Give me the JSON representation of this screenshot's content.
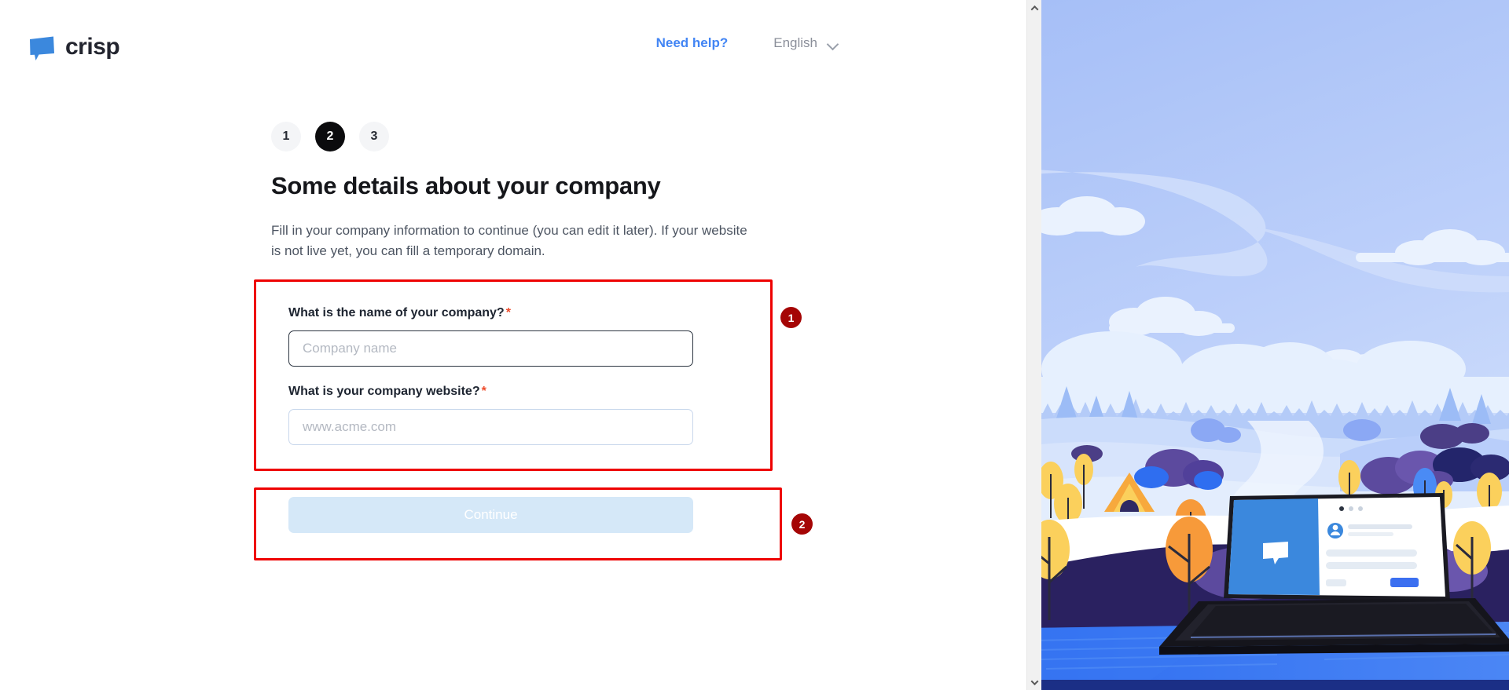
{
  "brand": {
    "logo_text": "crisp",
    "logo_icon": "speech-bubble-icon",
    "logo_color": "#3b88dd"
  },
  "header": {
    "need_help_label": "Need help?",
    "language_label": "English",
    "language_chevron_icon": "chevron-down-icon"
  },
  "onboarding": {
    "steps": [
      {
        "label": "1",
        "active": false
      },
      {
        "label": "2",
        "active": true
      },
      {
        "label": "3",
        "active": false
      }
    ],
    "title": "Some details about your company",
    "description": "Fill in your company information to continue (you can edit it later). If your website is not live yet, you can fill a temporary domain."
  },
  "form": {
    "fields": [
      {
        "label": "What is the name of your company?",
        "required_marker": "*",
        "placeholder": "Company name",
        "value": "",
        "focused": true
      },
      {
        "label": "What is your company website?",
        "required_marker": "*",
        "placeholder": "www.acme.com",
        "value": "",
        "focused": false
      }
    ],
    "submit_label": "Continue",
    "submit_disabled": true
  },
  "annotations": [
    {
      "badge": "1",
      "target": "company-fields-group"
    },
    {
      "badge": "2",
      "target": "continue-button"
    }
  ],
  "scrollbar": {
    "up_arrow_icon": "chevron-up-icon",
    "down_arrow_icon": "chevron-down-icon"
  },
  "illustration": {
    "name": "winter-landscape-with-laptop-illustration",
    "colors": {
      "sky_top": "#a9c1f6",
      "sky_bottom": "#cfe0fb",
      "snow": "#ffffff",
      "night_ground": "#2a2160",
      "desk_blue": "#2f6ef0",
      "tree_orange": "#f79a3a",
      "tree_yellow": "#f9cf52",
      "bush_purple": "#5c4a9e",
      "accent_blue": "#3b88dd"
    }
  },
  "colors": {
    "accent": "#4285f4",
    "required": "#ee4b2b",
    "annotation": "#ee0000",
    "annotation_badge": "#a50505",
    "active_step": "#0b0b0d",
    "disabled_button": "#d5e8f8"
  }
}
